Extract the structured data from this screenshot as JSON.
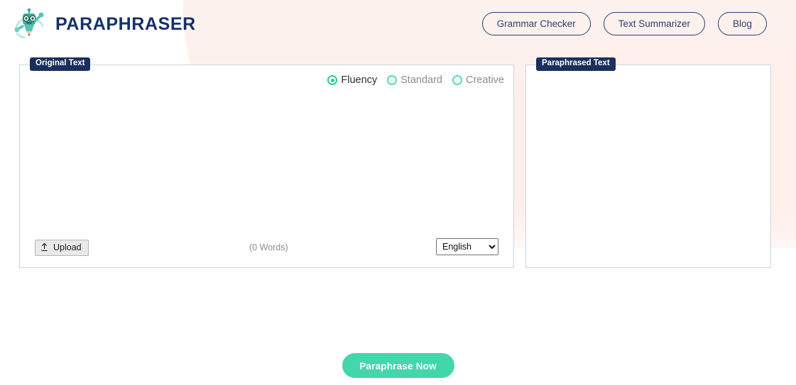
{
  "brand": {
    "title": "PARAPHRASER",
    "logo_icon": "robot-pencil-mascot-icon",
    "accent_color": "#2ecc9a",
    "title_color": "#16306b"
  },
  "nav": {
    "items": [
      {
        "label": "Grammar Checker",
        "name": "nav-grammar-checker"
      },
      {
        "label": "Text Summarizer",
        "name": "nav-text-summarizer"
      },
      {
        "label": "Blog",
        "name": "nav-blog"
      }
    ]
  },
  "editor": {
    "left_panel": {
      "tag": "Original Text",
      "textarea_value": "",
      "textarea_placeholder": "",
      "modes": [
        {
          "label": "Fluency",
          "selected": true
        },
        {
          "label": "Standard",
          "selected": false
        },
        {
          "label": "Creative",
          "selected": false
        }
      ],
      "toolbar": {
        "upload_label": "Upload",
        "upload_icon": "upload-arrow-icon",
        "word_count": "(0 Words)",
        "language_selected": "English",
        "language_options": [
          "English"
        ],
        "chevron_icon": "chevron-down-icon"
      }
    },
    "right_panel": {
      "tag": "Paraphrased Text",
      "textarea_value": "",
      "textarea_placeholder": ""
    }
  },
  "cta": {
    "label": "Paraphrase Now",
    "color": "#43d6aa"
  }
}
